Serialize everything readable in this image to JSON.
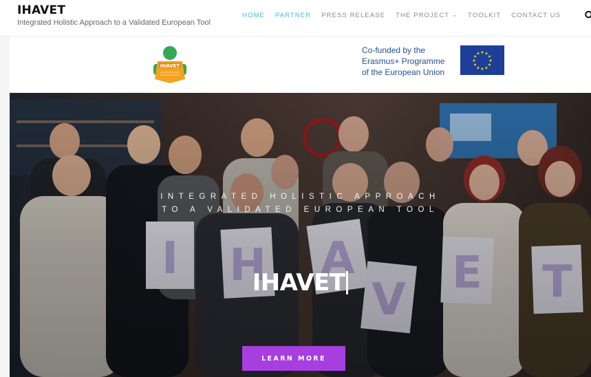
{
  "header": {
    "brand": "IHAVET",
    "tagline": "Integrated Holistic Approach to a Validated European Tool"
  },
  "nav": {
    "items": [
      {
        "label": "HOME"
      },
      {
        "label": "PARTNER"
      },
      {
        "label": "PRESS RELEASE"
      },
      {
        "label": "THE PROJECT"
      },
      {
        "label": "TOOLKIT"
      },
      {
        "label": "CONTACT US"
      }
    ],
    "active_color": "#41b8e0",
    "search_icon": "search-icon"
  },
  "logos": {
    "ihavet_logo_text": "IHAVET",
    "cofund_lines": [
      "Co-funded by the",
      "Erasmus+ Programme",
      "of the European Union"
    ],
    "eu_flag_icon": "eu-flag-icon"
  },
  "hero": {
    "subtitle_line1": "INTEGRATED HOLISTIC APPROACH",
    "subtitle_line2": "TO A VALIDATED EUROPEAN TOOL",
    "title": "IHAVET",
    "cta_label": "LEARN MORE",
    "cta_color": "#a63ee0",
    "sign_letters": [
      "I",
      "H",
      "A",
      "V",
      "E",
      "T"
    ]
  }
}
